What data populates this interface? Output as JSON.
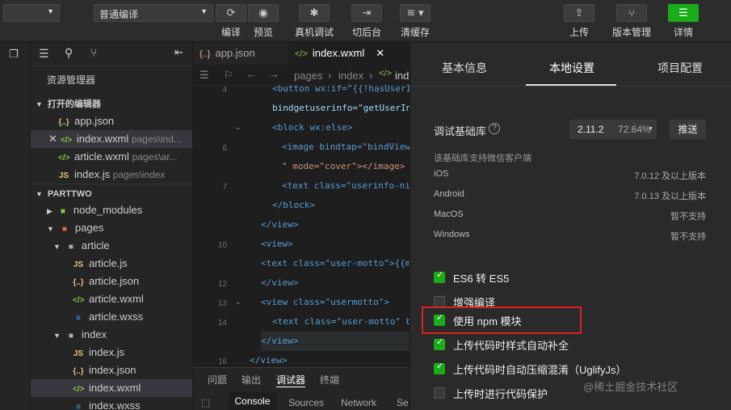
{
  "toolbar": {
    "compile_mode": "普通编译",
    "buttons": [
      {
        "label": "编译",
        "icon": "refresh-icon"
      },
      {
        "label": "预览",
        "icon": "eye-icon"
      },
      {
        "label": "真机调试",
        "icon": "bug-icon"
      },
      {
        "label": "切后台",
        "icon": "switch-background-icon"
      },
      {
        "label": "清缓存",
        "icon": "layers-icon"
      },
      {
        "label": "上传",
        "icon": "upload-icon"
      },
      {
        "label": "版本管理",
        "icon": "branch-icon"
      },
      {
        "label": "详情",
        "icon": "menu-icon"
      }
    ]
  },
  "explorer": {
    "title": "资源管理器",
    "open_editors_label": "打开的编辑器",
    "open_editors": [
      {
        "name": "app.json",
        "path": "",
        "type": "json"
      },
      {
        "name": "index.wxml",
        "path": "pages\\ind...",
        "type": "wxml"
      },
      {
        "name": "article.wxml",
        "path": "pages\\ar...",
        "type": "wxml"
      },
      {
        "name": "index.js",
        "path": "pages\\index",
        "type": "js"
      }
    ],
    "project_label": "PARTTWO",
    "tree": [
      {
        "name": "node_modules"
      },
      {
        "name": "pages"
      },
      {
        "name": "article"
      },
      {
        "name": "article.js"
      },
      {
        "name": "article.json"
      },
      {
        "name": "article.wxml"
      },
      {
        "name": "article.wxss"
      },
      {
        "name": "index"
      },
      {
        "name": "index.js"
      },
      {
        "name": "index.json"
      },
      {
        "name": "index.wxml"
      },
      {
        "name": "index.wxss"
      }
    ]
  },
  "editor": {
    "tabs": [
      "app.json",
      "index.wxml"
    ],
    "breadcrumb": [
      "pages",
      "index",
      "ind"
    ],
    "line_numbers": [
      "4",
      "",
      "6",
      "",
      "7",
      "",
      "",
      "10",
      "",
      "12",
      "13",
      "14",
      "",
      "16"
    ],
    "lines": [
      {
        "t": "<button wx:if=\"{{!hasUserI"
      },
      {
        "t": "bindgetuserinfo=\"getUserIn"
      },
      {
        "t": "<block wx:else>"
      },
      {
        "t": "<image bindtap=\"bindView"
      },
      {
        "t": "\" mode=\"cover\"></image>"
      },
      {
        "t": "<text class=\"userinfo-ni"
      },
      {
        "t": "</block>"
      },
      {
        "t": "</view>"
      },
      {
        "t": "<view>"
      },
      {
        "t": "<text class=\"user-motto\">{{m"
      },
      {
        "t": "</view>"
      },
      {
        "t": "<view class=\"usermotto\">"
      },
      {
        "t": "<text class=\"user-motto\" b"
      },
      {
        "t": "</view>"
      },
      {
        "t": "</view>"
      }
    ]
  },
  "bottom": {
    "tabs": [
      "问题",
      "输出",
      "调试器",
      "终端"
    ],
    "subtabs": [
      "Console",
      "Sources",
      "Network",
      "Se"
    ]
  },
  "panel": {
    "tabs": [
      "基本信息",
      "本地设置",
      "项目配置"
    ],
    "active_tab": "本地设置",
    "lib_label": "调试基础库",
    "lib_version": "2.11.2",
    "lib_percent": "72.64%",
    "push_label": "推送",
    "support_note": "该基础库支持微信客户端",
    "platforms": [
      {
        "name": "iOS",
        "value": "7.0.12 及以上版本"
      },
      {
        "name": "Android",
        "value": "7.0.13 及以上版本"
      },
      {
        "name": "MacOS",
        "value": "暂不支持"
      },
      {
        "name": "Windows",
        "value": "暂不支持"
      }
    ],
    "options": [
      {
        "label": "ES6 转 ES5",
        "checked": true
      },
      {
        "label": "增强编译",
        "checked": false
      },
      {
        "label": "使用 npm 模块",
        "checked": true
      },
      {
        "label": "上传代码时样式自动补全",
        "checked": true
      },
      {
        "label": "上传代码时自动压缩混淆（UglifyJs）",
        "checked": true
      },
      {
        "label": "上传时进行代码保护",
        "checked": false
      }
    ],
    "highlight_color": "#e02020"
  },
  "watermark": "@稀土掘金技术社区"
}
